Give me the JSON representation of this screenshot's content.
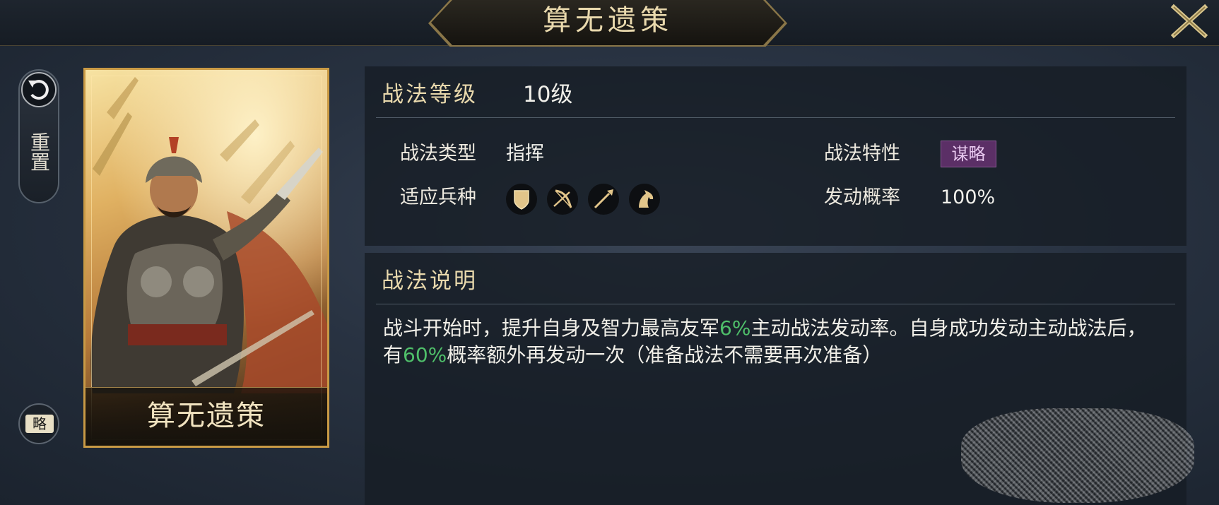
{
  "title": "算无遗策",
  "sidebar": {
    "reset_label": "重置",
    "strategy_label": "略"
  },
  "card": {
    "name": "算无遗策"
  },
  "info": {
    "level_label": "战法等级",
    "level_value": "10级",
    "type_label": "战法类型",
    "type_value": "指挥",
    "trait_label": "战法特性",
    "trait_value": "谋略",
    "troops_label": "适应兵种",
    "troops": [
      "shield-icon",
      "bow-icon",
      "spear-icon",
      "horse-icon"
    ],
    "chance_label": "发动概率",
    "chance_value": "100%"
  },
  "description": {
    "heading": "战法说明",
    "p1": "战斗开始时，提升自身及智力最高友军",
    "h1": "6%",
    "p2": "主动战法发动率。自身成功发动主动战法后，有",
    "h2": "60%",
    "p3": "概率额外再发动一次（准备战法不需要再次准备）"
  },
  "colors": {
    "gold": "#e9d9ad",
    "highlight": "#4fbf6a",
    "trait_badge": "#5b2f66"
  }
}
